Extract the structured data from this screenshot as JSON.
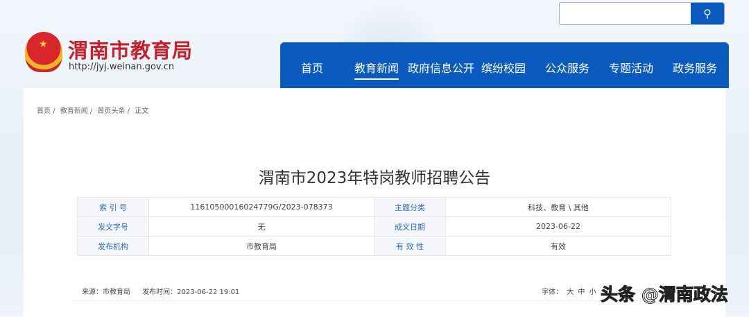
{
  "header": {
    "site_name": "渭南市教育局",
    "site_url": "http://jyj.weinan.gov.cn",
    "search_placeholder": ""
  },
  "nav": [
    "首页",
    "教育新闻",
    "政府信息公开",
    "缤纷校园",
    "公众服务",
    "专题活动",
    "政务服务"
  ],
  "breadcrumb": [
    "首页 /",
    "教育新闻 /",
    "首页头条 /",
    "正文"
  ],
  "article": {
    "title": "渭南市2023年特岗教师招聘公告"
  },
  "info_table": [
    [
      {
        "label": "索 引 号",
        "value": "11610500016024779G/2023-078373"
      },
      {
        "label": "主题分类",
        "value": "科技、教育 \\ 其他"
      }
    ],
    [
      {
        "label": "发文字号",
        "value": "无"
      },
      {
        "label": "成文日期",
        "value": "2023-06-22"
      }
    ],
    [
      {
        "label": "发布机构",
        "value": "市教育局"
      },
      {
        "label": "有 效 性",
        "value": "有效"
      }
    ]
  ],
  "meta": {
    "source": "来源：市教育局",
    "publish_time": "发布时间：2023-06-22 19:01"
  },
  "font_size": {
    "label": "字体：",
    "large": "大",
    "medium": "中",
    "small": "小"
  },
  "watermark": "头条 @渭南政法"
}
